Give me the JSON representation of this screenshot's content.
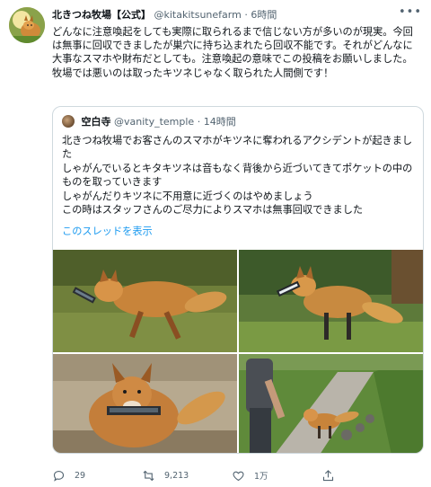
{
  "tweet": {
    "display_name": "北きつね牧場【公式】",
    "handle": "@kitakitsunefarm",
    "separator": "·",
    "time": "6時間",
    "text": "どんなに注意喚起をしても実際に取られるまで信じない方が多いのが現実。今回は無事に回収できましたが巣穴に持ち込まれたら回収不能です。それがどんなに大事なスマホや財布だとしても。注意喚起の意味でこの投稿をお願いしました。牧場では悪いのは取ったキツネじゃなく取られた人間側です！",
    "more_icon": "more-icon"
  },
  "quote": {
    "display_name": "空白寺",
    "handle": "@vanity_temple",
    "separator": "·",
    "time": "14時間",
    "text_lines": [
      "北きつね牧場でお客さんのスマホがキツネに奪われるアクシデントが起きました",
      "しゃがんでいるとキタキツネは音もなく背後から近づいてきてポケットの中のものを取っていきます",
      "しゃがんだりキツネに不用意に近づくのはやめましょう",
      "この時はスタッフさんのご尽力によりスマホは無事回収できました"
    ],
    "thread_link": "このスレッドを表示",
    "photos": [
      {
        "name": "fox-with-phone-running-photo",
        "icon": "photo"
      },
      {
        "name": "fox-with-phone-walking-photo",
        "icon": "photo"
      },
      {
        "name": "fox-holding-phone-closeup-photo",
        "icon": "photo"
      },
      {
        "name": "staff-chasing-fox-photo",
        "icon": "photo"
      }
    ]
  },
  "actions": {
    "reply_count": "29",
    "retweet_count": "9,213",
    "like_count": "1万",
    "share_label": ""
  },
  "colors": {
    "accent": "#1d9bf0",
    "text": "#0f1419",
    "muted": "#536471",
    "border": "#cfd9de"
  }
}
